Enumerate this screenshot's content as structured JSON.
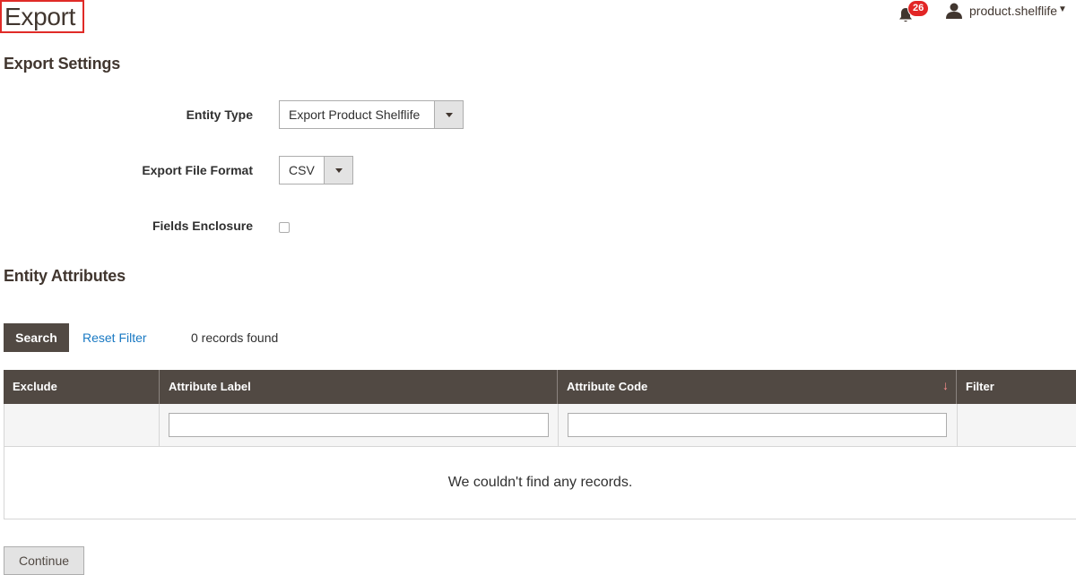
{
  "page": {
    "title": "Export"
  },
  "header": {
    "notifications_count": "26",
    "user_name": "product.shelflife"
  },
  "export_settings": {
    "title": "Export Settings",
    "entity_type_label": "Entity Type",
    "entity_type_value": "Export Product Shelflife",
    "file_format_label": "Export File Format",
    "file_format_value": "CSV",
    "fields_enclosure_label": "Fields Enclosure"
  },
  "entity_attributes": {
    "title": "Entity Attributes",
    "search_label": "Search",
    "reset_label": "Reset Filter",
    "records_found": "0 records found",
    "columns": [
      "Exclude",
      "Attribute Label",
      "Attribute Code",
      "Filter"
    ],
    "empty_message": "We couldn't find any records."
  },
  "actions": {
    "continue_label": "Continue"
  },
  "icons": {
    "bell": "bell-icon",
    "user": "user-icon",
    "caret": "caret-down-icon",
    "sort": "sort-arrow-icon",
    "select_arrow": "chevron-down-icon"
  },
  "colors": {
    "header_bg": "#514943",
    "link": "#1979c3",
    "badge": "#e22626",
    "title_border": "#e02b27"
  }
}
